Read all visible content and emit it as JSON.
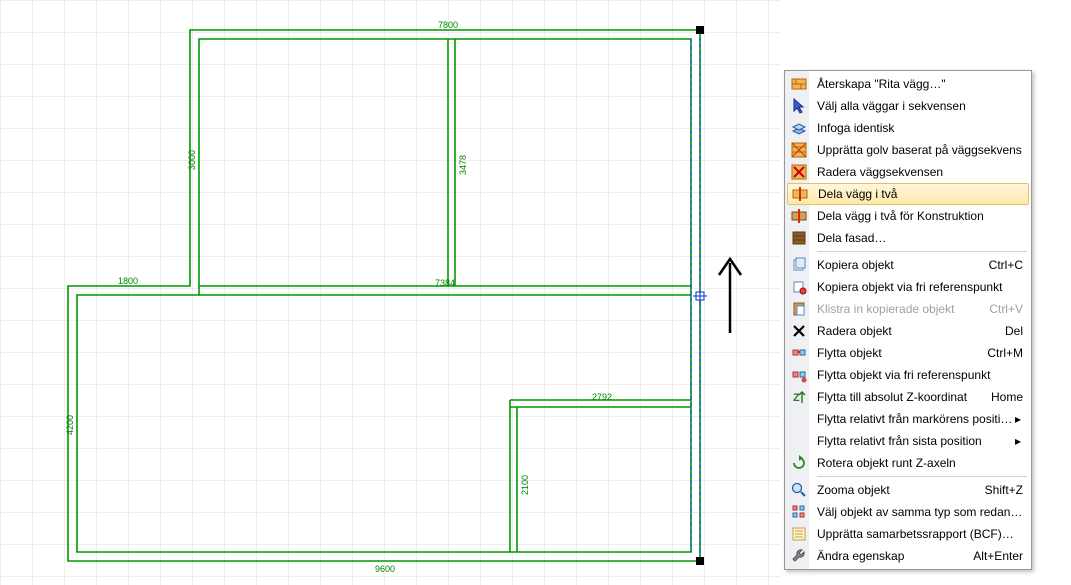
{
  "plan": {
    "dimensions": {
      "top": "7800",
      "left_upper": "3000",
      "left_lower": "4200",
      "bottom_notch": "1800",
      "middle_horiz": "7384",
      "inner_vert_upper": "3478",
      "inner_right_horiz": "2792",
      "inner_vert_lower": "2100",
      "bottom": "9600"
    }
  },
  "arrow": {
    "meaning": "up-arrow-annotation"
  },
  "menu": {
    "items": [
      {
        "key": "recreate",
        "label": "Återskapa \"Rita vägg…\"",
        "shortcut": "",
        "submenu": false,
        "disabled": false
      },
      {
        "key": "selectall",
        "label": "Välj alla väggar i sekvensen",
        "shortcut": "",
        "submenu": false,
        "disabled": false
      },
      {
        "key": "insert",
        "label": "Infoga identisk",
        "shortcut": "",
        "submenu": false,
        "disabled": false
      },
      {
        "key": "floor",
        "label": "Upprätta golv baserat på väggsekvens",
        "shortcut": "",
        "submenu": false,
        "disabled": false
      },
      {
        "key": "delseq",
        "label": "Radera väggsekvensen",
        "shortcut": "",
        "submenu": false,
        "disabled": false
      },
      {
        "key": "split",
        "label": "Dela vägg i två",
        "shortcut": "",
        "submenu": false,
        "disabled": false,
        "highlight": true
      },
      {
        "key": "splitc",
        "label": "Dela vägg i två för Konstruktion",
        "shortcut": "",
        "submenu": false,
        "disabled": false
      },
      {
        "key": "facade",
        "label": "Dela fasad…",
        "shortcut": "",
        "submenu": false,
        "disabled": false
      },
      {
        "sep": true
      },
      {
        "key": "copy",
        "label": "Kopiera objekt",
        "shortcut": "Ctrl+C",
        "submenu": false,
        "disabled": false
      },
      {
        "key": "copyref",
        "label": "Kopiera objekt via fri referenspunkt",
        "shortcut": "",
        "submenu": false,
        "disabled": false
      },
      {
        "key": "paste",
        "label": "Klistra in kopierade objekt",
        "shortcut": "Ctrl+V",
        "submenu": false,
        "disabled": true
      },
      {
        "key": "del",
        "label": "Radera objekt",
        "shortcut": "Del",
        "submenu": false,
        "disabled": false
      },
      {
        "key": "move",
        "label": "Flytta objekt",
        "shortcut": "Ctrl+M",
        "submenu": false,
        "disabled": false
      },
      {
        "key": "moveref",
        "label": "Flytta objekt via fri referenspunkt",
        "shortcut": "",
        "submenu": false,
        "disabled": false
      },
      {
        "key": "movez",
        "label": "Flytta till absolut Z-koordinat",
        "shortcut": "Home",
        "submenu": false,
        "disabled": false
      },
      {
        "key": "relcursor",
        "label": "Flytta relativt från markörens position",
        "shortcut": "",
        "submenu": true,
        "disabled": false
      },
      {
        "key": "rellast",
        "label": "Flytta relativt från sista position",
        "shortcut": "",
        "submenu": true,
        "disabled": false
      },
      {
        "key": "rotz",
        "label": "Rotera objekt runt Z-axeln",
        "shortcut": "",
        "submenu": false,
        "disabled": false
      },
      {
        "sep": true
      },
      {
        "key": "zoom",
        "label": "Zooma objekt",
        "shortcut": "Shift+Z",
        "submenu": false,
        "disabled": false
      },
      {
        "key": "selsame",
        "label": "Välj objekt av samma typ som redan valts",
        "shortcut": "",
        "submenu": false,
        "disabled": false
      },
      {
        "key": "bcf",
        "label": "Upprätta samarbetssrapport (BCF)…",
        "shortcut": "",
        "submenu": false,
        "disabled": false
      },
      {
        "key": "props",
        "label": "Ändra egenskap",
        "shortcut": "Alt+Enter",
        "submenu": false,
        "disabled": false
      }
    ]
  },
  "icons": {
    "recreate": "wall",
    "selectall": "select",
    "insert": "stack",
    "floor": "hatch",
    "delseq": "delhatch",
    "split": "splitwall",
    "splitc": "splitwall2",
    "facade": "facade",
    "copy": "copy",
    "copyref": "copyref",
    "paste": "paste",
    "del": "xblack",
    "move": "move",
    "moveref": "moveref",
    "movez": "zarrow",
    "relcursor": "",
    "rellast": "",
    "rotz": "rotate",
    "zoom": "zoom",
    "selsame": "grid",
    "bcf": "report",
    "props": "wrench"
  }
}
